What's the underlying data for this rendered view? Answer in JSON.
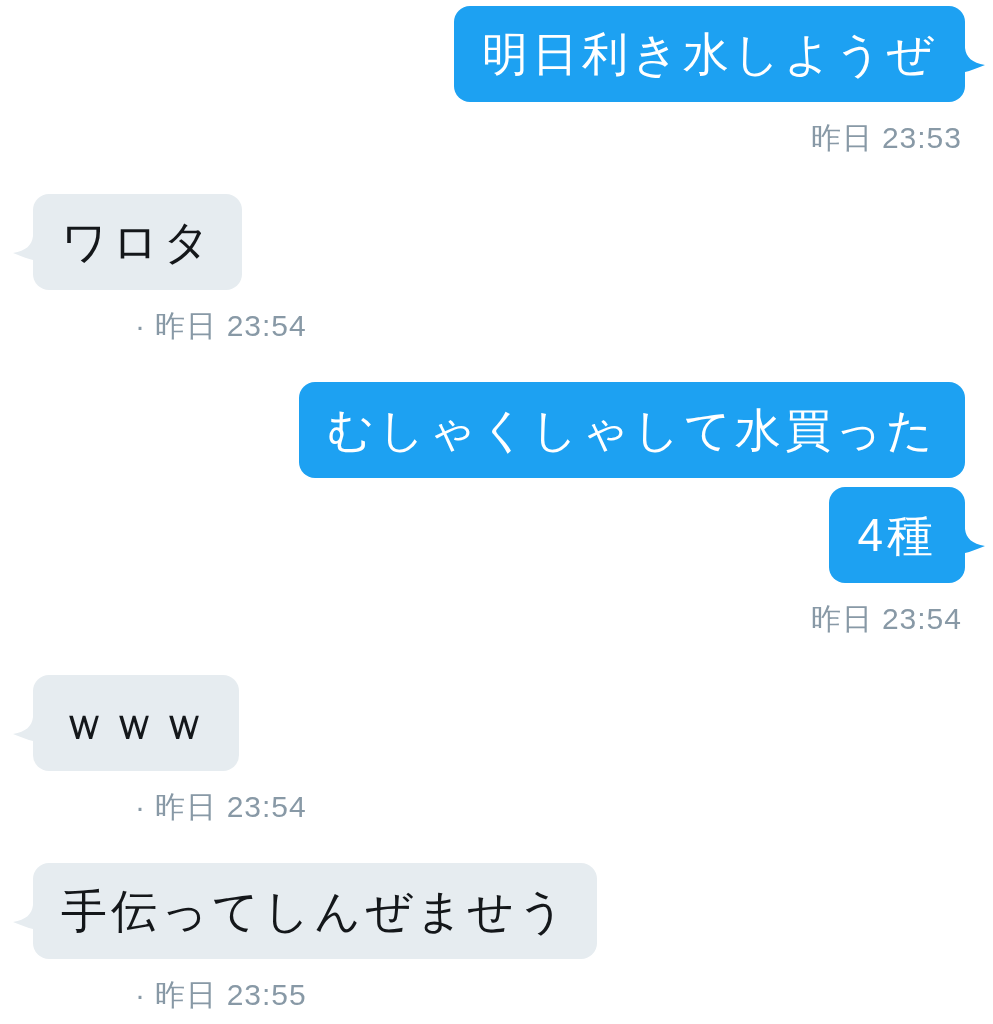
{
  "messages": [
    {
      "kind": "sent",
      "text": "明日利き水しようぜ",
      "tail": true,
      "timestamp": "昨日 23:53"
    },
    {
      "kind": "received",
      "text": "ワロタ",
      "tail": true,
      "timestamp": "· 昨日 23:54"
    },
    {
      "kind": "sent",
      "text": "むしゃくしゃして水買った",
      "tail": false
    },
    {
      "kind": "sent",
      "text": "4種",
      "tail": true,
      "timestamp": "昨日 23:54"
    },
    {
      "kind": "received",
      "text": "ｗｗｗ",
      "tail": true,
      "timestamp": "· 昨日 23:54"
    },
    {
      "kind": "received",
      "text": "手伝ってしんぜませう",
      "tail": true,
      "timestamp": "· 昨日 23:55"
    }
  ]
}
